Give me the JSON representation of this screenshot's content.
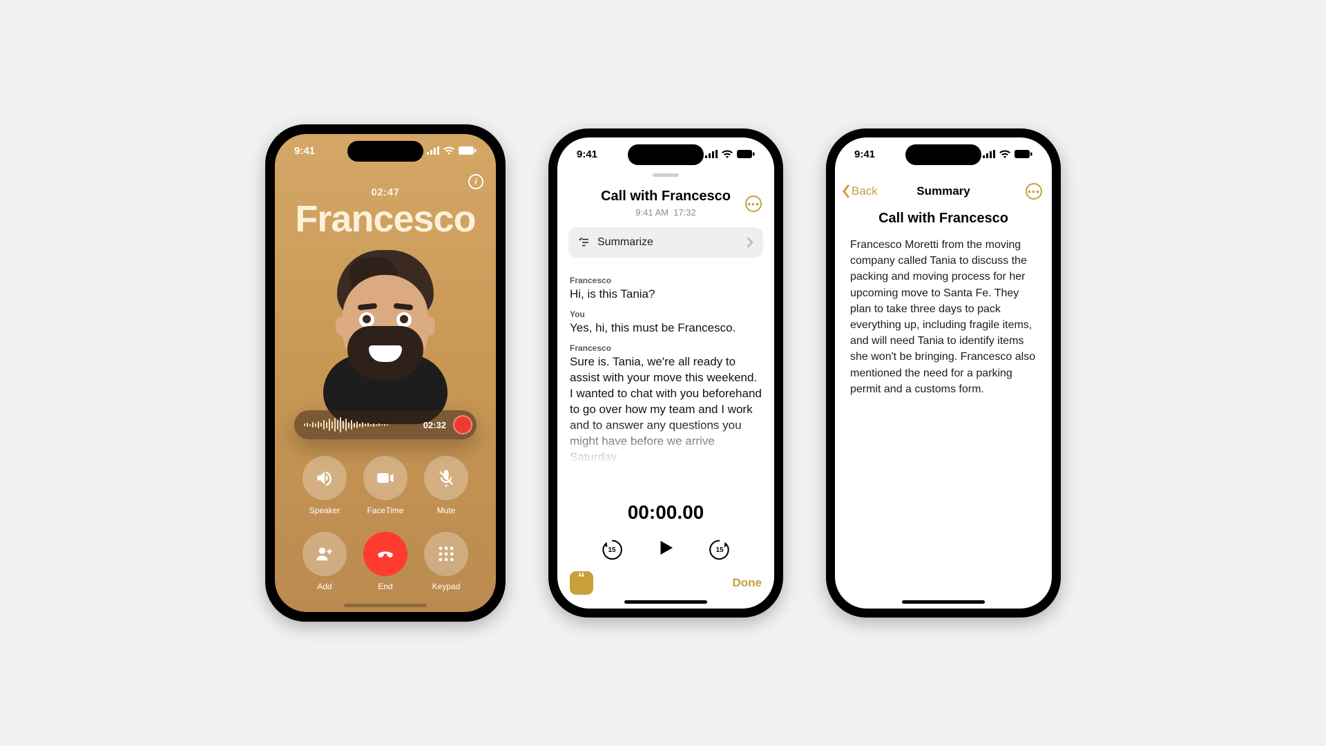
{
  "status": {
    "time": "9:41"
  },
  "call": {
    "duration": "02:47",
    "name": "Francesco",
    "recording_time": "02:32",
    "buttons": {
      "speaker": "Speaker",
      "facetime": "FaceTime",
      "mute": "Mute",
      "add": "Add",
      "end": "End",
      "keypad": "Keypad"
    }
  },
  "note": {
    "title": "Call with Francesco",
    "sub_time": "9:41 AM",
    "sub_duration": "17:32",
    "summarize_label": "Summarize",
    "transcript": [
      {
        "speaker": "Francesco",
        "text": "Hi, is this Tania?"
      },
      {
        "speaker": "You",
        "text": "Yes, hi, this must be Francesco."
      },
      {
        "speaker": "Francesco",
        "text": "Sure is. Tania, we're all ready to assist with your move this weekend. I wanted to chat with you beforehand to go over how my team and I work and to answer any questions you might have before we arrive Saturday"
      }
    ],
    "player_time": "00:00.00",
    "skip_seconds": "15",
    "done_label": "Done"
  },
  "summary": {
    "back_label": "Back",
    "nav_title": "Summary",
    "heading": "Call with Francesco",
    "body": "Francesco Moretti from the moving company called Tania to discuss the packing and moving process for her upcoming move to Santa Fe. They plan to take three days to pack everything up, including fragile items, and will need Tania to identify items she won't be bringing. Francesco also mentioned the need for a parking permit and a customs form."
  }
}
